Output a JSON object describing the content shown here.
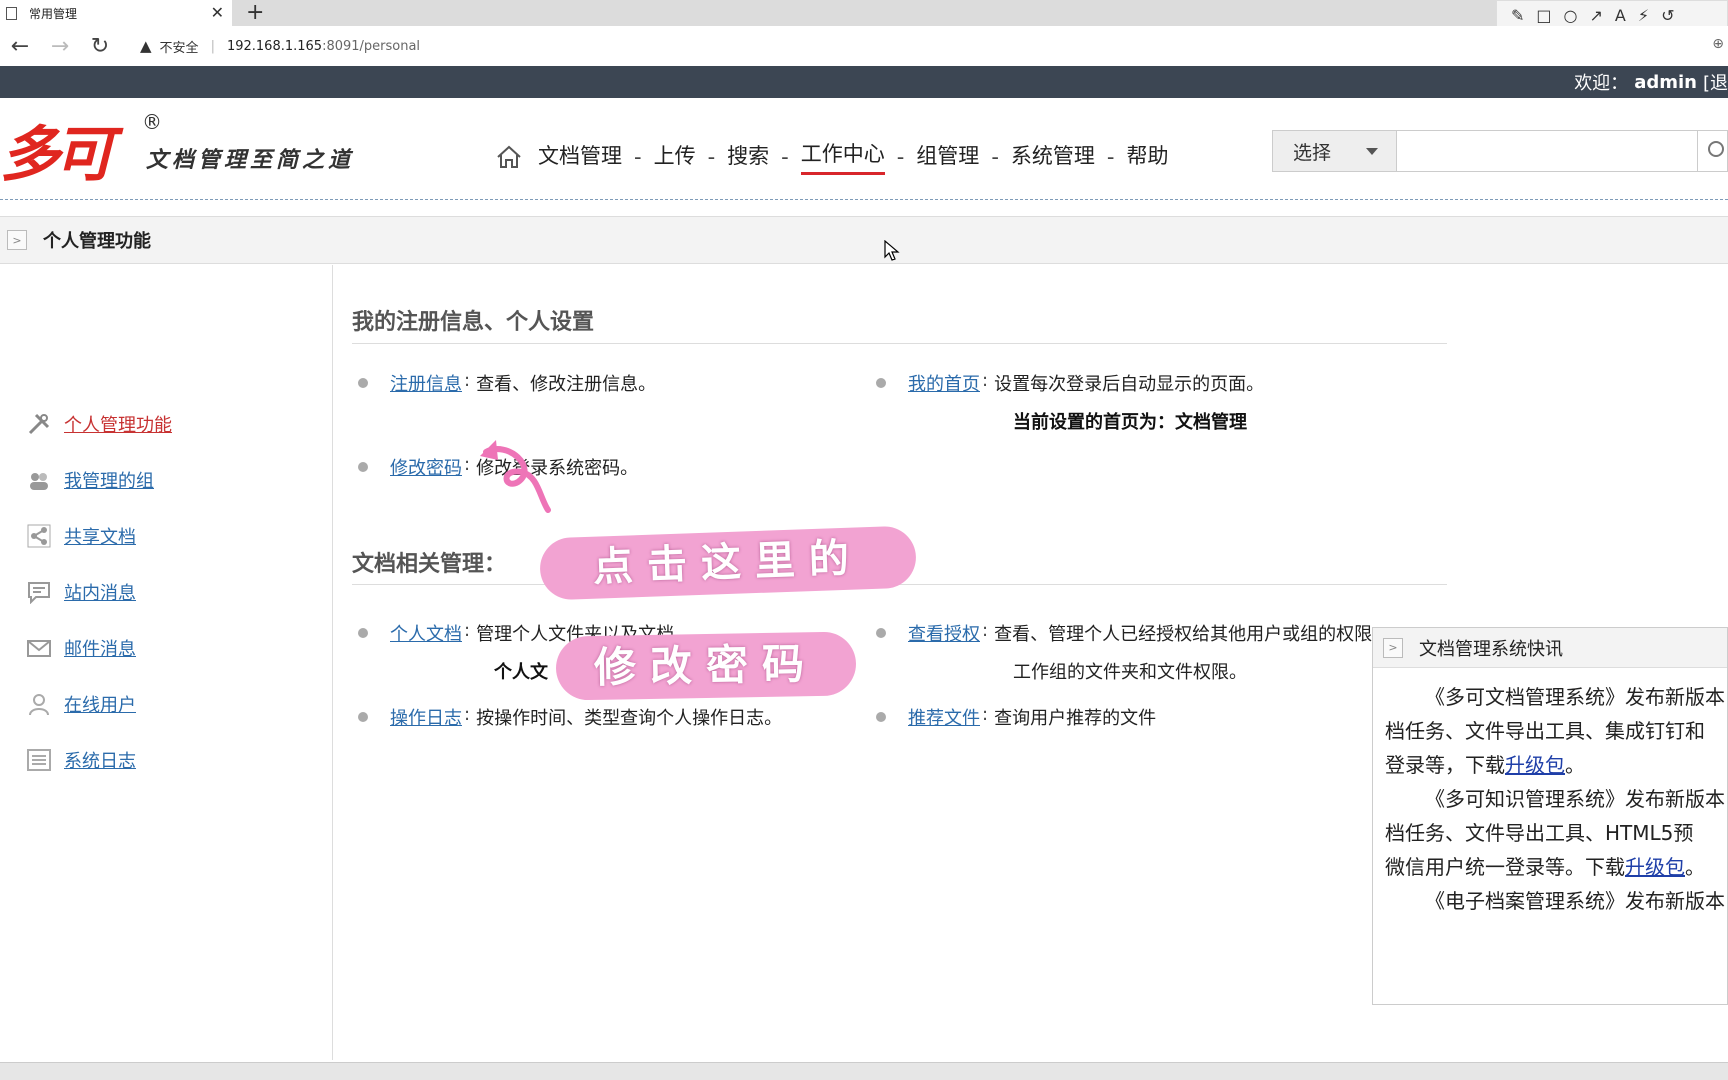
{
  "browser": {
    "tab_title": "常用管理",
    "tab_close": "✕",
    "new_tab": "+",
    "security_label": "不安全",
    "url_host": "192.168.1.165",
    "url_path": ":8091/personal"
  },
  "topbar": {
    "welcome_label": "欢迎：",
    "username": "admin",
    "logout_fragment": "[退"
  },
  "brand": {
    "logo_text": "多可",
    "registered_mark": "®",
    "slogan": "文档管理至简之道"
  },
  "nav": {
    "items": [
      {
        "label": "文档管理"
      },
      {
        "label": "上传"
      },
      {
        "label": "搜索"
      },
      {
        "label": "工作中心",
        "active": true
      },
      {
        "label": "组管理"
      },
      {
        "label": "系统管理"
      },
      {
        "label": "帮助"
      }
    ],
    "separator": "-"
  },
  "search": {
    "select_label": "选择",
    "input_value": ""
  },
  "panel": {
    "title": "个人管理功能"
  },
  "sidebar": {
    "items": [
      {
        "label": "个人管理功能",
        "icon": "tools-icon",
        "active": true
      },
      {
        "label": "我管理的组",
        "icon": "group-icon"
      },
      {
        "label": "共享文档",
        "icon": "share-icon"
      },
      {
        "label": "站内消息",
        "icon": "message-icon"
      },
      {
        "label": "邮件消息",
        "icon": "mail-icon"
      },
      {
        "label": "在线用户",
        "icon": "user-icon"
      },
      {
        "label": "系统日志",
        "icon": "log-icon"
      }
    ]
  },
  "section1": {
    "title": "我的注册信息、个人设置",
    "entries": [
      {
        "link": "注册信息",
        "desc": "查看、修改注册信息。"
      },
      {
        "link": "我的首页",
        "desc": "设置每次登录后自动显示的页面。"
      },
      {
        "link": "修改密码",
        "desc": "修改登录系统密码。"
      }
    ],
    "homepage_note": "当前设置的首页为：文档管理"
  },
  "section2": {
    "title": "文档相关管理：",
    "entries": [
      {
        "link": "个人文档",
        "desc": "管理个人文件夹以及文档。"
      },
      {
        "link": "查看授权",
        "desc": "查看、管理个人已经授权给其他用户或组的权限"
      },
      {
        "link": "操作日志",
        "desc": "按操作时间、类型查询个人操作日志。"
      },
      {
        "link": "推荐文件",
        "desc": "查询用户推荐的文件"
      }
    ],
    "personal_note": "个人文",
    "auth_desc_line2": "工作组的文件夹和文件权限。"
  },
  "overlay": {
    "sticker1": "点击这里的",
    "sticker2": "修改密码"
  },
  "news": {
    "title": "文档管理系统快讯",
    "p1_line1": "《多可文档管理系统》发布新版本",
    "p1_line2": "档任务、文件导出工具、集成钉钉和",
    "p1_line3_pre": "登录等，下载",
    "p1_link": "升级包",
    "p1_line3_post": "。",
    "p2_line1": "《多可知识管理系统》发布新版本",
    "p2_line2": "档任务、文件导出工具、HTML5预",
    "p2_line3_pre": "微信用户统一登录等。下载",
    "p2_link": "升级包",
    "p2_line3_post": "。",
    "p3_line1": "《电子档案管理系统》发布新版本"
  },
  "colors": {
    "topstrip": "#3c4653",
    "logo_red": "#e0261f",
    "link_blue": "#2b6bab",
    "active_red": "#c73232",
    "sticker_pink": "#f2a3d2"
  }
}
